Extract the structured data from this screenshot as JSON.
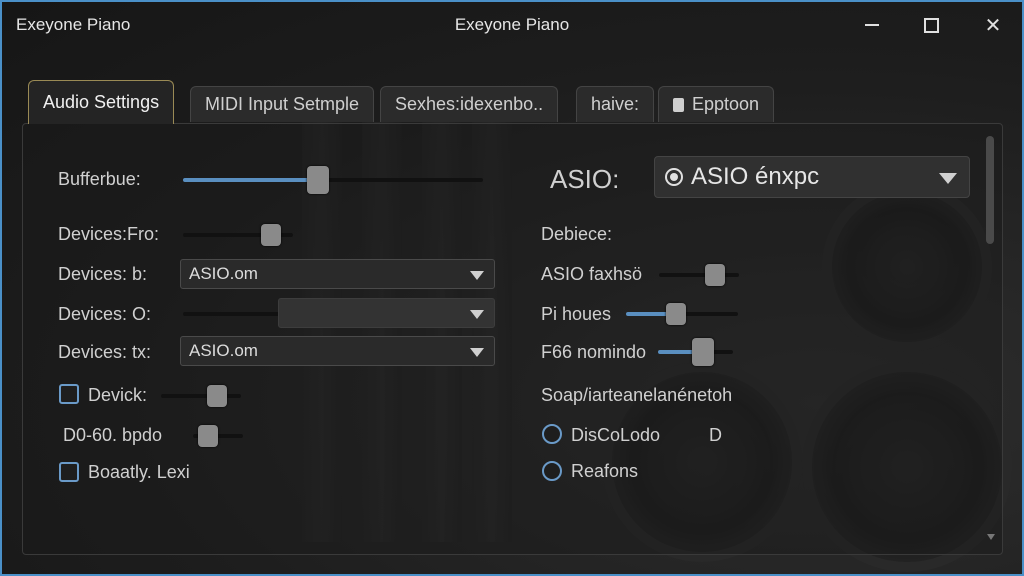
{
  "window": {
    "app_title": "Exeyone Piano",
    "center_title": "Exeyone Piano"
  },
  "tabs": [
    {
      "label": "Audio Settings",
      "active": true
    },
    {
      "label": "MIDI Input Setmple"
    },
    {
      "label": "Sexhes:idexenbo.."
    },
    {
      "label": "haive:"
    },
    {
      "label": "Epptoon",
      "icon": "document-icon"
    }
  ],
  "left": {
    "buffer_label": "Bufferbue:",
    "buffer_value": 0.45,
    "devices_fro_label": "Devices:Fro:",
    "devices_fro_value": 0.8,
    "devices_b_label": "Devices: b:",
    "devices_b_select": "ASIO.om",
    "devices_o_label": "Devices: O:",
    "devices_o_select": "",
    "devices_tx_label": "Devices: tx:",
    "devices_tx_select": "ASIO.om",
    "devick_label": "Devick:",
    "devick_value": 0.7,
    "bpdo_label": "D0-60. bpdo",
    "bpdo_value": 0.3,
    "boaatly_label": "Boaatly. Lexi"
  },
  "right": {
    "asio_label": "ASIO:",
    "asio_select": "ASIO énxpc",
    "debiece_label": "Debiece:",
    "asio_faxhso_label": "ASIO faxhsö",
    "asio_faxhso_value": 0.7,
    "pi_houes_label": "Pi houes",
    "pi_houes_value": 0.45,
    "f66_label": "F66 nomindo",
    "f66_value": 0.6,
    "soap_label": "Soap/iarteanelanénetoh",
    "radio1_label": "DisCoLodo",
    "radio1_suffix": "D",
    "radio2_label": "Reafons"
  },
  "colors": {
    "accent": "#5a8fc0",
    "window_border": "#4a90c8",
    "active_tab_border": "#9a8a55"
  }
}
